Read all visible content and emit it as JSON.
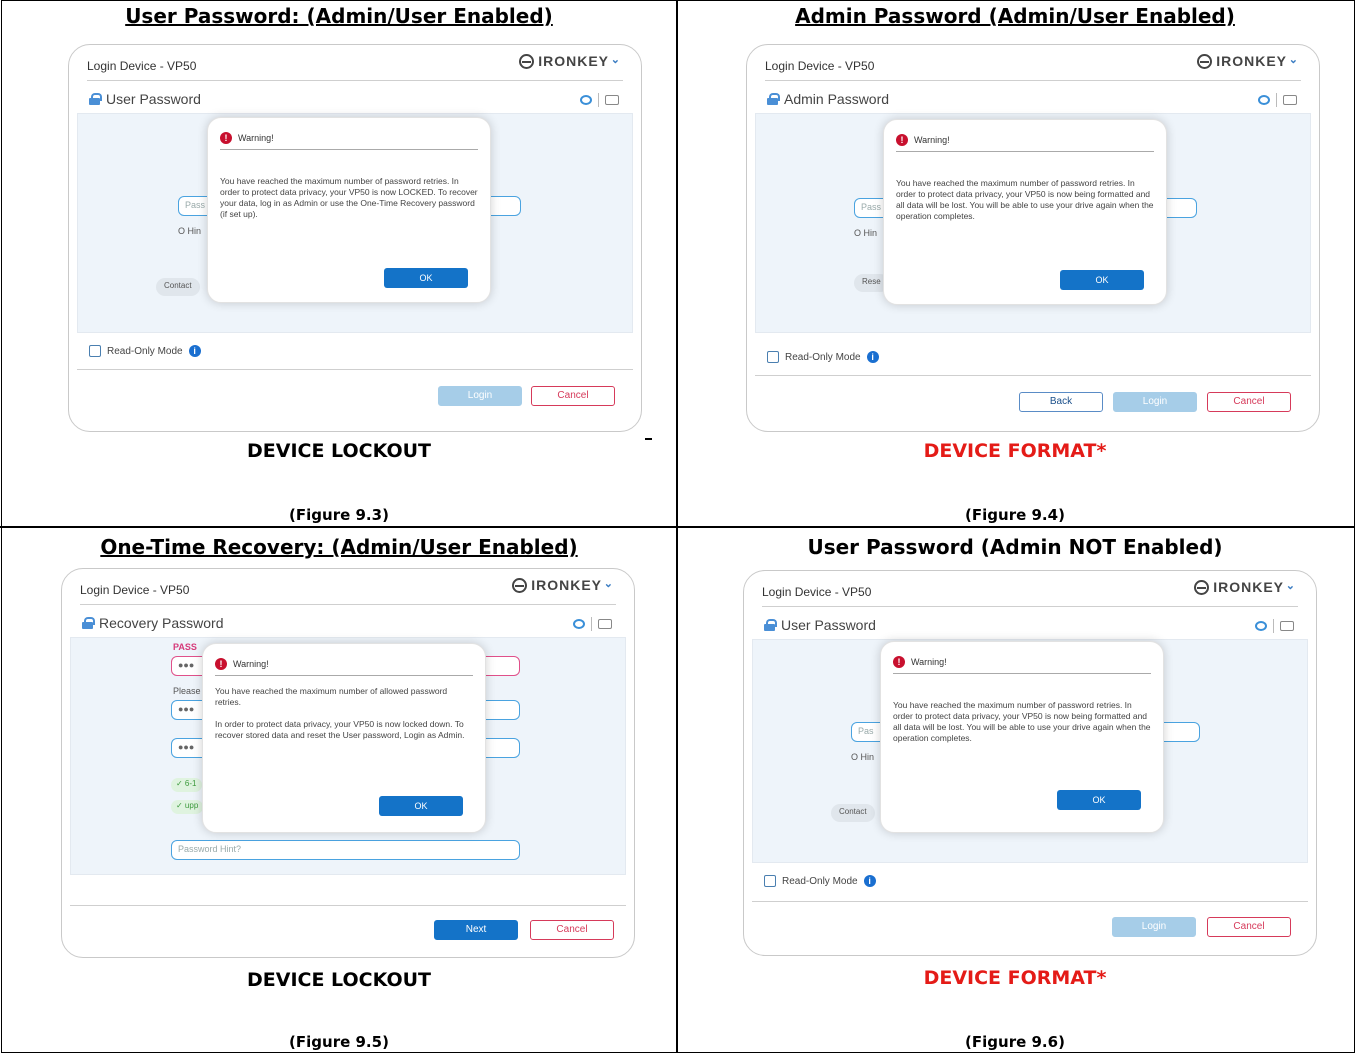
{
  "cells": [
    {
      "title": "User Password: (Admin/User Enabled)",
      "caption": "DEVICE LOCKOUT",
      "figure": "(Figure 9.3)",
      "window_title": "Login Device - VP50",
      "brand": "IRONKEY",
      "section": "User Password",
      "input_placeholder": "Pass",
      "hint_text": "O Hin",
      "pill_text": "Contact",
      "dialog_title": "Warning!",
      "dialog_text": "You have reached the maximum number of password retries. In order to protect data privacy, your VP50 is now LOCKED. To recover your data, log in as Admin or use the One-Time Recovery password (if set up).",
      "ok": "OK",
      "readonly": "Read-Only Mode",
      "login": "Login",
      "cancel": "Cancel"
    },
    {
      "title": "Admin Password (Admin/User Enabled)",
      "caption": "DEVICE FORMAT*",
      "figure": "(Figure 9.4)",
      "window_title": "Login Device - VP50",
      "brand": "IRONKEY",
      "section": "Admin Password",
      "input_placeholder": "Pass",
      "hint_text": "O Hin",
      "pill_text": "Rese",
      "dialog_title": "Warning!",
      "dialog_text": "You have reached the maximum number of password retries. In order to protect data privacy, your VP50 is now being formatted and all data will be lost. You will be able to use your drive again when the operation completes.",
      "ok": "OK",
      "readonly": "Read-Only Mode",
      "back": "Back",
      "login": "Login",
      "cancel": "Cancel"
    },
    {
      "title": "One-Time Recovery: (Admin/User Enabled)",
      "caption": "DEVICE LOCKOUT",
      "figure": "(Figure 9.5)",
      "window_title": "Login Device - VP50",
      "brand": "IRONKEY",
      "section": "Recovery Password",
      "pass_label": "PASS",
      "please_label": "Please",
      "dots": "●●●",
      "chip1": "✓ 6-1",
      "chip2": "✓ upp",
      "hint_placeholder": "Password Hint?",
      "dialog_title": "Warning!",
      "dialog_text": "You have reached the maximum number of allowed password retries.\n\nIn order to protect data privacy, your VP50 is now locked down. To recover stored data and reset the User password, Login as Admin.",
      "ok": "OK",
      "next": "Next",
      "cancel": "Cancel"
    },
    {
      "title": "User Password (Admin NOT Enabled)",
      "caption": "DEVICE FORMAT*",
      "figure": "(Figure 9.6)",
      "window_title": "Login Device - VP50",
      "brand": "IRONKEY",
      "section": "User Password",
      "input_placeholder": "Pas",
      "hint_text": "O Hin",
      "pill_text": "Contact",
      "dialog_title": "Warning!",
      "dialog_text": "You have reached the maximum number of password retries. In order to protect data privacy, your VP50 is now being formatted and all data will be lost. You will be able to use your drive again when the operation completes.",
      "ok": "OK",
      "readonly": "Read-Only Mode",
      "login": "Login",
      "cancel": "Cancel"
    }
  ]
}
